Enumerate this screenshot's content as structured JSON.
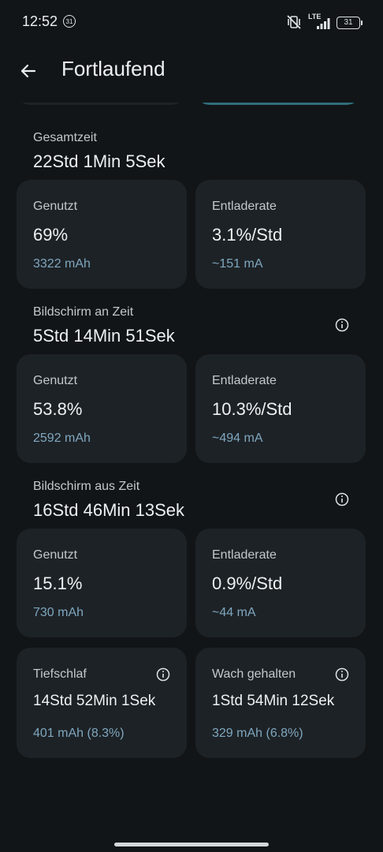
{
  "status_bar": {
    "time": "12:52",
    "calendar_badge": "31",
    "network": "LTE",
    "battery_level": "31"
  },
  "header": {
    "title": "Fortlaufend"
  },
  "sections": {
    "total": {
      "label": "Gesamtzeit",
      "value": "22Std 1Min 5Sek",
      "used_label": "Genutzt",
      "used_percent": "69%",
      "used_mah": "3322 mAh",
      "rate_label": "Entladerate",
      "rate_value": "3.1%/Std",
      "rate_current": "~151 mA"
    },
    "screen_on": {
      "label": "Bildschirm an Zeit",
      "value": "5Std 14Min 51Sek",
      "used_label": "Genutzt",
      "used_percent": "53.8%",
      "used_mah": "2592 mAh",
      "rate_label": "Entladerate",
      "rate_value": "10.3%/Std",
      "rate_current": "~494 mA"
    },
    "screen_off": {
      "label": "Bildschirm aus Zeit",
      "value": "16Std 46Min 13Sek",
      "used_label": "Genutzt",
      "used_percent": "15.1%",
      "used_mah": "730 mAh",
      "rate_label": "Entladerate",
      "rate_value": "0.9%/Std",
      "rate_current": "~44 mA"
    },
    "deep_sleep": {
      "label": "Tiefschlaf",
      "value": "14Std 52Min 1Sek",
      "detail": "401 mAh (8.3%)"
    },
    "awake": {
      "label": "Wach gehalten",
      "value": "1Std 54Min 12Sek",
      "detail": "329 mAh (6.8%)"
    }
  },
  "colors": {
    "background": "#111518",
    "card": "#1d2226",
    "accent_text": "#7fa7bf"
  }
}
